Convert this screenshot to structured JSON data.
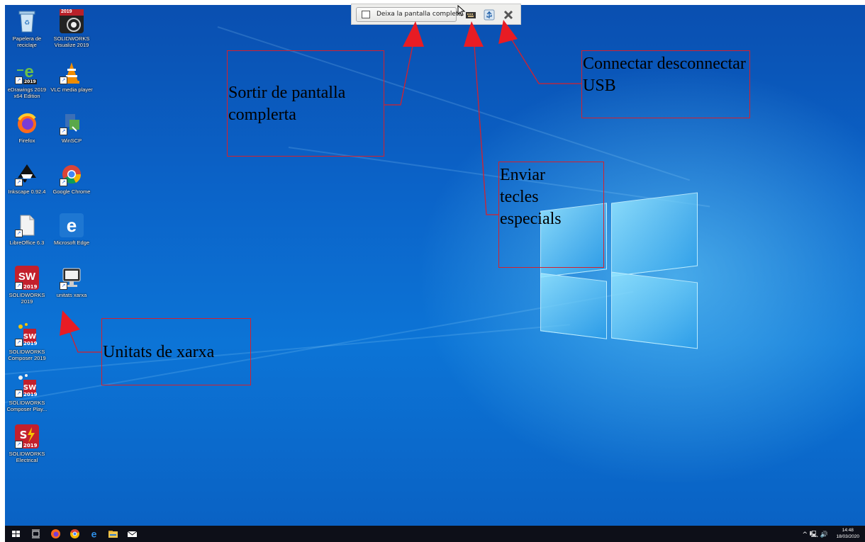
{
  "desktop": {
    "icons": [
      {
        "label": "Papelera de reciclaje"
      },
      {
        "label": "SOLIDWORKS Visualize 2019",
        "badge": "2019"
      },
      {
        "label": "eDrawings 2019 x64 Edition",
        "badge": "2019"
      },
      {
        "label": "VLC media player"
      },
      {
        "label": "Firefox"
      },
      {
        "label": "WinSCP"
      },
      {
        "label": "Inkscape 0.92.4"
      },
      {
        "label": "Google Chrome"
      },
      {
        "label": "LibreOffice 6.3"
      },
      {
        "label": "Microsoft Edge"
      },
      {
        "label": "SOLIDWORKS 2019",
        "badge": "2019"
      },
      {
        "label": "unitats xarxa"
      },
      {
        "label": "SOLIDWORKS Composer 2019",
        "badge": "2019"
      },
      {
        "label": "SOLIDWORKS Composer Play...",
        "badge": "2019"
      },
      {
        "label": "SOLIDWORKS Electrical",
        "badge": "2019"
      }
    ]
  },
  "toolbar": {
    "fullscreen_label": "Deixa la pantalla completa"
  },
  "annotations": {
    "exit_fullscreen": "Sortir de pantalla complerta",
    "usb": "Connectar desconnectar USB",
    "special_keys": "Enviar tecles especials",
    "network_drives": "Unitats de xarxa",
    "color": "#d6202c"
  },
  "taskbar": {
    "time": "14:48",
    "date": "18/03/2020"
  }
}
